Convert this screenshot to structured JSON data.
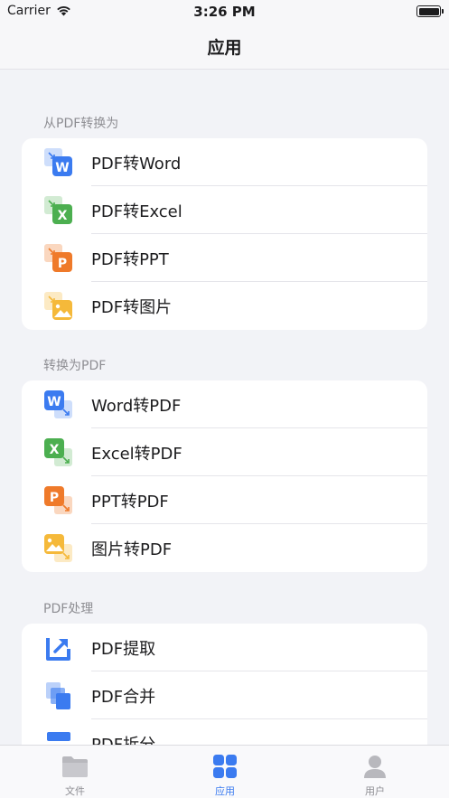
{
  "status": {
    "carrier": "Carrier",
    "time": "3:26 PM"
  },
  "nav": {
    "title": "应用"
  },
  "sections": [
    {
      "title": "从PDF转换为",
      "items": [
        {
          "label": "PDF转Word",
          "icon": "pdf-to-word-icon"
        },
        {
          "label": "PDF转Excel",
          "icon": "pdf-to-excel-icon"
        },
        {
          "label": "PDF转PPT",
          "icon": "pdf-to-ppt-icon"
        },
        {
          "label": "PDF转图片",
          "icon": "pdf-to-image-icon"
        }
      ]
    },
    {
      "title": "转换为PDF",
      "items": [
        {
          "label": "Word转PDF",
          "icon": "word-to-pdf-icon"
        },
        {
          "label": "Excel转PDF",
          "icon": "excel-to-pdf-icon"
        },
        {
          "label": "PPT转PDF",
          "icon": "ppt-to-pdf-icon"
        },
        {
          "label": "图片转PDF",
          "icon": "image-to-pdf-icon"
        }
      ]
    },
    {
      "title": "PDF处理",
      "items": [
        {
          "label": "PDF提取",
          "icon": "pdf-extract-icon"
        },
        {
          "label": "PDF合并",
          "icon": "pdf-merge-icon"
        },
        {
          "label": "PDF拆分",
          "icon": "pdf-split-icon"
        }
      ]
    }
  ],
  "tabs": [
    {
      "label": "文件",
      "icon": "folder-icon",
      "active": false
    },
    {
      "label": "应用",
      "icon": "apps-grid-icon",
      "active": true
    },
    {
      "label": "用户",
      "icon": "user-icon",
      "active": false
    }
  ],
  "colors": {
    "word": "#3b7bf0",
    "excel": "#4caf50",
    "ppt": "#ef7a2a",
    "image": "#f5b93a",
    "accent": "#3b7bf0",
    "tab_inactive": "#b8b8bd"
  }
}
